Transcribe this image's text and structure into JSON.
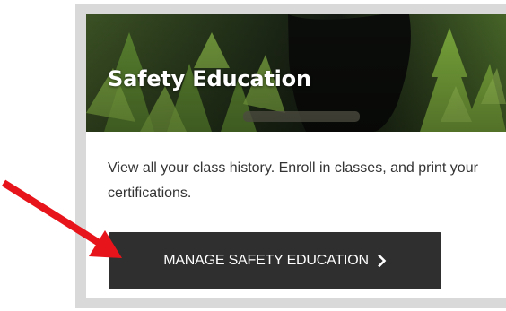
{
  "card": {
    "title": "Safety Education",
    "description": "View all your class history. Enroll in classes, and print your certifications.",
    "button_label": "MANAGE SAFETY EDUCATION",
    "button_icon": "chevron-right-icon"
  },
  "annotation": {
    "icon": "red-arrow-icon",
    "color": "#e8141b"
  },
  "colors": {
    "button_bg": "#2f2f2f",
    "frame": "#d9d9d9",
    "text": "#333333"
  }
}
